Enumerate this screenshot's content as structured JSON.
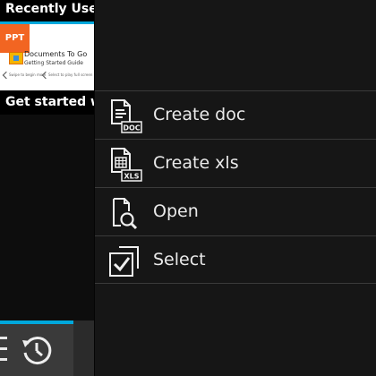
{
  "left_panel": {
    "header_title": "Recently Used",
    "thumbnail": {
      "badge": "PPT",
      "title": "Documents To Go",
      "subtitle": "Getting Started Guide",
      "note_left": "Swipe to begin more",
      "note_right": "Select to play full screen"
    },
    "footer_text": "Get started w"
  },
  "bottom_bar": {
    "menu_icon": "menu-lines-icon",
    "history_icon": "history-clock-icon"
  },
  "context_menu": {
    "items": [
      {
        "label": "Create doc",
        "icon": "doc-file-icon",
        "icon_badge": "DOC"
      },
      {
        "label": "Create xls",
        "icon": "xls-file-icon",
        "icon_badge": "XLS"
      },
      {
        "label": "Open",
        "icon": "open-file-icon"
      },
      {
        "label": "Select",
        "icon": "select-checkbox-icon"
      }
    ]
  },
  "colors": {
    "accent": "#00a8dc",
    "ppt_badge": "#f26522",
    "menu_background": "#161616",
    "menu_text": "#eaeaea"
  }
}
